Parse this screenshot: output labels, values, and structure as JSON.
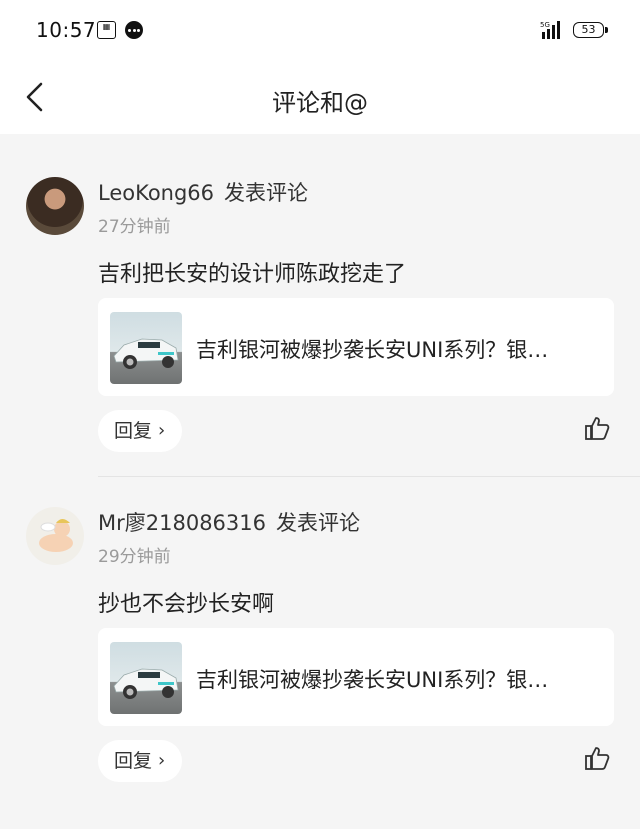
{
  "status_bar": {
    "time": "10:57",
    "network": "5G",
    "battery": "53"
  },
  "header": {
    "title": "评论和@"
  },
  "comments": [
    {
      "username": "LeoKong66",
      "action": "发表评论",
      "time_ago": "27分钟前",
      "text": "吉利把长安的设计师陈政挖走了",
      "card_title": "吉利银河被爆抄袭长安UNI系列？银…",
      "reply_label": "回复",
      "reply_chevron": "›"
    },
    {
      "username": "Mr廖218086316",
      "action": "发表评论",
      "time_ago": "29分钟前",
      "text": "抄也不会抄长安啊",
      "card_title": "吉利银河被爆抄袭长安UNI系列？银…",
      "reply_label": "回复",
      "reply_chevron": "›"
    }
  ]
}
